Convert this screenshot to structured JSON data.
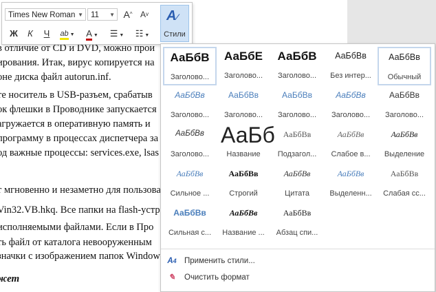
{
  "document": {
    "lines": [
      "в отличие от CD и DVD, можно прои",
      "ирования. Итак, вирус копируется на",
      "оне диска файл autorun.inf.",
      "те носитель в USB-разъем, срабатыв",
      "ок флешки в Проводнике запускается",
      "агружается в оперативную память и",
      "программу в процессах диспетчера за",
      "од важные процессы: services.exe, lsas",
      "т мгновенно и незаметно для пользова",
      "Vin32.VB.hkq. Все папки на flash-устр",
      "исполняемыми файлами. Если в Про",
      "ть файл от каталога невооруженным",
      "значки с изображением папок Window",
      "жет"
    ]
  },
  "toolbar": {
    "font_name": "Times New Roman",
    "font_size": "11",
    "grow_font": "A",
    "shrink_font": "A",
    "bold": "Ж",
    "italic": "К",
    "underline": "Ч",
    "highlight": "ab",
    "font_color": "A",
    "styles_label": "Стили"
  },
  "gallery": {
    "styles": [
      {
        "preview": "АаБбВ",
        "name": "Заголово..."
      },
      {
        "preview": "АаБбЕ",
        "name": "Заголово..."
      },
      {
        "preview": "АаБбВ",
        "name": "Заголово..."
      },
      {
        "preview": "АаБбВв",
        "name": "Без интер..."
      },
      {
        "preview": "АаБбВв",
        "name": "Обычный"
      },
      {
        "preview": "АаБбВв",
        "name": "Заголово..."
      },
      {
        "preview": "АаБбВв",
        "name": "Заголово..."
      },
      {
        "preview": "АаБбВв",
        "name": "Заголово..."
      },
      {
        "preview": "АаБбВв",
        "name": "Заголово..."
      },
      {
        "preview": "АаБбВв",
        "name": "Заголово..."
      },
      {
        "preview": "АаБбВв",
        "name": "Заголово..."
      },
      {
        "preview": "АаБб",
        "name": "Название"
      },
      {
        "preview": "АаБбВв",
        "name": "Подзагол..."
      },
      {
        "preview": "АаБбВв",
        "name": "Слабое в..."
      },
      {
        "preview": "АаБбВв",
        "name": "Выделение"
      },
      {
        "preview": "АаБбВв",
        "name": "Сильное ..."
      },
      {
        "preview": "АаБбВв",
        "name": "Строгий"
      },
      {
        "preview": "АаБбВв",
        "name": "Цитата"
      },
      {
        "preview": "АаБбВв",
        "name": "Выделенн..."
      },
      {
        "preview": "АаБбВв",
        "name": "Слабая сс..."
      },
      {
        "preview": "АаБбВв",
        "name": "Сильная с..."
      },
      {
        "preview": "АаБбВв",
        "name": "Название ..."
      },
      {
        "preview": "АаБбВв",
        "name": "Абзац спи..."
      }
    ],
    "apply_styles": "Применить стили...",
    "clear_format": "Очистить формат"
  },
  "colors": {
    "accent": "#2a5db0",
    "heading_blue": "#4a7ebb",
    "selection": "#c4d6ec"
  }
}
